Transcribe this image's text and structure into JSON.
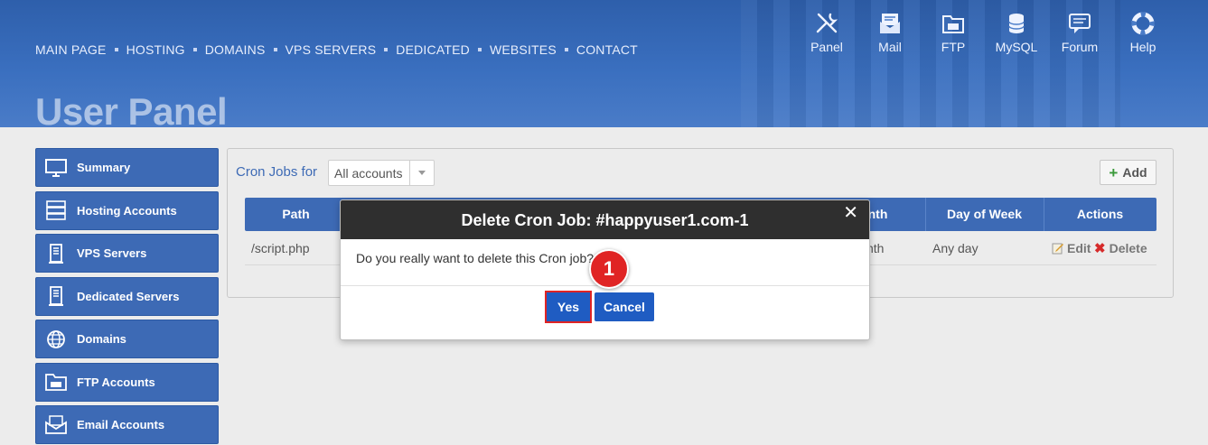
{
  "header": {
    "nav": [
      "MAIN PAGE",
      "HOSTING",
      "DOMAINS",
      "VPS SERVERS",
      "DEDICATED",
      "WEBSITES",
      "CONTACT"
    ],
    "page_title": "User Panel",
    "icons": [
      {
        "label": "Panel",
        "icon": "tools-icon"
      },
      {
        "label": "Mail",
        "icon": "mail-icon"
      },
      {
        "label": "FTP",
        "icon": "ftp-folder-icon"
      },
      {
        "label": "MySQL",
        "icon": "database-icon"
      },
      {
        "label": "Forum",
        "icon": "chat-icon"
      },
      {
        "label": "Help",
        "icon": "lifebuoy-icon"
      }
    ]
  },
  "sidebar": {
    "items": [
      {
        "label": "Summary",
        "icon": "monitor-icon"
      },
      {
        "label": "Hosting Accounts",
        "icon": "server-stack-icon"
      },
      {
        "label": "VPS Servers",
        "icon": "vps-server-icon"
      },
      {
        "label": "Dedicated Servers",
        "icon": "dedicated-server-icon"
      },
      {
        "label": "Domains",
        "icon": "globe-icon"
      },
      {
        "label": "FTP Accounts",
        "icon": "ftp-folder-icon"
      },
      {
        "label": "Email Accounts",
        "icon": "envelope-icon"
      }
    ]
  },
  "cron": {
    "label": "Cron Jobs for",
    "account_select": "All accounts",
    "add_label": "Add",
    "columns": [
      "Path",
      "nth",
      "Day of Week",
      "Actions"
    ],
    "row": {
      "path": "/script.php",
      "month": "nth",
      "day_of_week": "Any day",
      "edit": "Edit",
      "delete": "Delete"
    }
  },
  "modal": {
    "title": "Delete Cron Job: #happyuser1.com-1",
    "message": "Do you really want to delete this Cron job?",
    "yes": "Yes",
    "cancel": "Cancel",
    "close": "✕"
  },
  "annotation": {
    "step": "1"
  },
  "colors": {
    "header": "#3a6fbf",
    "sidebar": "#3d6ab5",
    "button": "#1f5cc2",
    "highlight": "#e02424",
    "modal_header": "#2f2f2f"
  }
}
